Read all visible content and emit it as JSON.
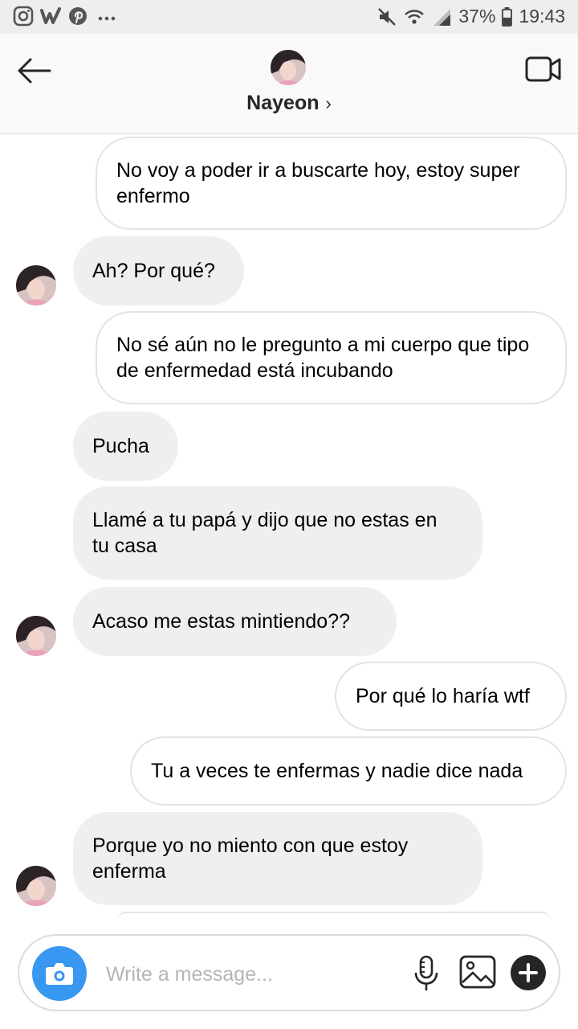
{
  "status_bar": {
    "battery": "37%",
    "time": "19:43",
    "left_icons": [
      "instagram-icon",
      "wattpad-icon",
      "pinterest-icon",
      "more-dots-icon"
    ],
    "right_icons": [
      "mute-icon",
      "wifi-icon",
      "signal-icon",
      "battery-icon"
    ]
  },
  "header": {
    "contact_name": "Nayeon",
    "chevron": "›",
    "icons": [
      "back-arrow-icon",
      "video-call-icon",
      "avatar"
    ]
  },
  "messages": [
    {
      "from": "me",
      "text": "No voy a poder ir a buscarte hoy, estoy super enfermo"
    },
    {
      "from": "them",
      "text": "Ah? Por qué?",
      "avatar": true
    },
    {
      "from": "me",
      "text": "No sé aún no le pregunto a mi cuerpo que tipo de enfermedad está incubando"
    },
    {
      "from": "them",
      "text": "Pucha"
    },
    {
      "from": "them",
      "text": "Llamé a tu papá y dijo que no estas en tu casa"
    },
    {
      "from": "them",
      "text": "Acaso me estas mintiendo??",
      "avatar": true
    },
    {
      "from": "me",
      "text": "Por qué lo haría wtf"
    },
    {
      "from": "me",
      "text": "Tu a veces te enfermas y nadie dice nada"
    },
    {
      "from": "them",
      "text": "Porque yo no miento con que estoy enferma",
      "avatar": true
    }
  ],
  "composer": {
    "placeholder": "Write a message...",
    "value": "",
    "icons": [
      "camera-icon",
      "microphone-icon",
      "gallery-icon",
      "plus-icon"
    ]
  },
  "colors": {
    "accent": "#3897f0",
    "received_bubble": "#efefef",
    "sent_border": "#e3e3e3",
    "header_bg": "#f9f9f9"
  }
}
